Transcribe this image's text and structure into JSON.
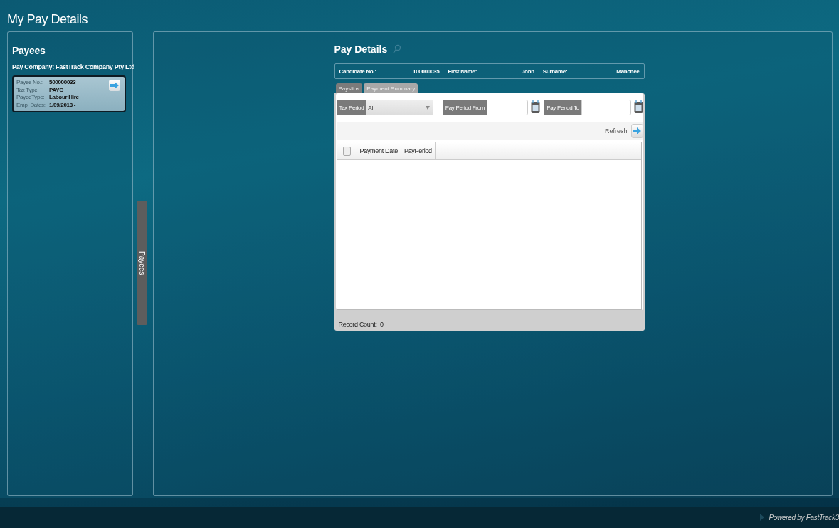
{
  "page_title": "My Pay Details",
  "payees_panel": {
    "title": "Payees",
    "company_label": "Pay Company:",
    "company": "FastTrack Company Pty Ltd",
    "payee_card": {
      "fields": [
        {
          "label": "Payee No.:",
          "value": "500000033"
        },
        {
          "label": "Tax Type:",
          "value": "PAYG"
        },
        {
          "label": "PayeeType:",
          "value": "Labour Hire"
        },
        {
          "label": "Emp. Dates:",
          "value": "1/09/2013 -"
        }
      ]
    }
  },
  "side_tab": {
    "label": "Payees"
  },
  "pay_details": {
    "title": "Pay Details",
    "candidate": [
      {
        "label": "Candidate No.:",
        "value": "100000035"
      },
      {
        "label": "First Name:",
        "value": "John"
      },
      {
        "label": "Surname:",
        "value": "Manchee"
      }
    ],
    "tabs": [
      {
        "label": "Payslips",
        "selected": true
      },
      {
        "label": "Payment Summary",
        "selected": false
      }
    ],
    "filters": {
      "tax_period_label": "Tax Period",
      "tax_period_value": "All",
      "from_label": "Pay Period From",
      "to_label": "Pay Period To"
    },
    "refresh": "Refresh",
    "table": {
      "select_all": {
        "checked": false
      },
      "columns": [
        "Payment Date",
        "PayPeriod"
      ]
    },
    "record_count": "Record Count:  0"
  },
  "footer": {
    "text": "Powered by FastTrack3"
  }
}
